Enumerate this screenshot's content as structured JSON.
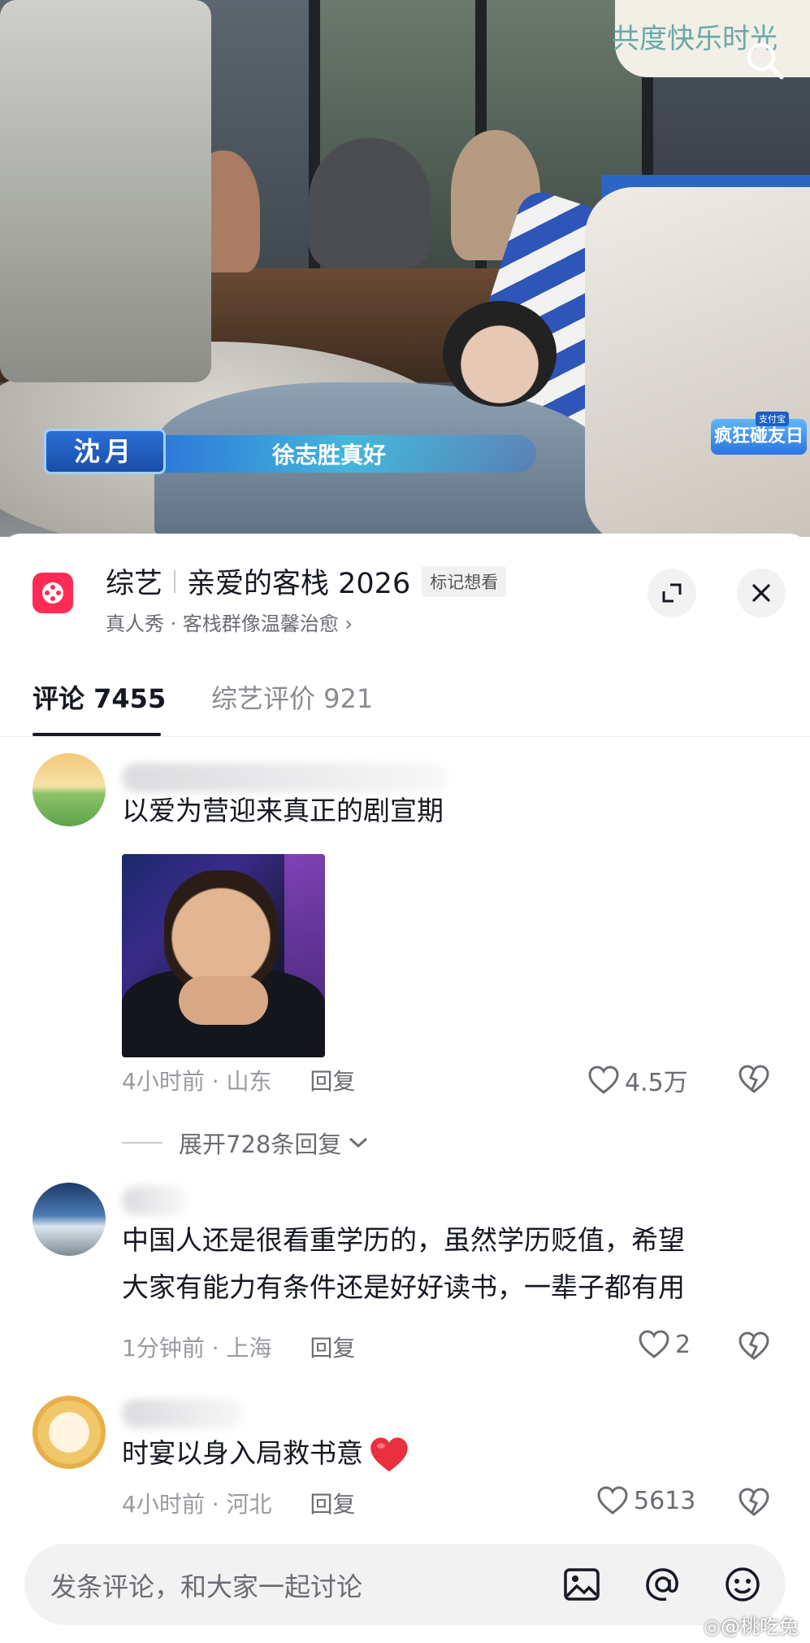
{
  "video": {
    "top_sign_text": "共度快乐时光",
    "sign_text": "疯 碰",
    "caption_name": "沈月",
    "caption_line": "徐志胜真好",
    "brand_badge": "疯狂碰友日",
    "brand_badge_sub": "支付宝",
    "search_icon": "search-icon"
  },
  "show": {
    "category": "综艺",
    "title": "亲爱的客栈 2026",
    "want_tag": "标记想看",
    "subtitle": "真人秀 · 客栈群像温馨治愈 ›",
    "logo_color": "#fe2c55"
  },
  "tabs": [
    {
      "label": "评论 7455",
      "active": true
    },
    {
      "label": "综艺评价 921",
      "active": false
    }
  ],
  "comments": [
    {
      "text": "以爱为营迎来真正的剧宣期",
      "time": "4小时前",
      "location": "山东",
      "reply_label": "回复",
      "likes": "4.5万",
      "has_image": true,
      "expand_replies": "展开728条回复"
    },
    {
      "text_line1": "中国人还是很看重学历的，虽然学历贬值，希望",
      "text_line2": "大家有能力有条件还是好好读书，一辈子都有用",
      "time": "1分钟前",
      "location": "上海",
      "reply_label": "回复",
      "likes": "2"
    },
    {
      "text": "时宴以身入局救书意",
      "emoji": "heart",
      "time": "4小时前",
      "location": "河北",
      "reply_label": "回复",
      "likes": "5613"
    }
  ],
  "input_bar": {
    "placeholder": "发条评论，和大家一起讨论",
    "icons": [
      "image-icon",
      "mention-icon",
      "emoji-icon"
    ]
  },
  "watermark": "◎@桃吃兔"
}
